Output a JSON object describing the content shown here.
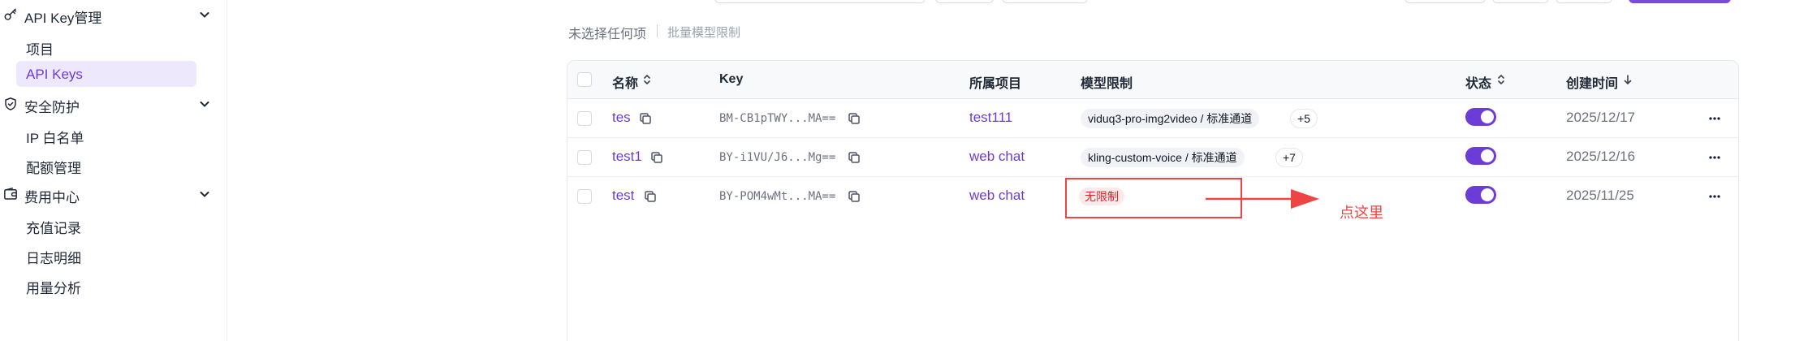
{
  "sidebar": {
    "groups": [
      {
        "label": "API Key管理",
        "icon": "key-icon",
        "items": [
          "项目",
          "API Keys"
        ]
      },
      {
        "label": "安全防护",
        "icon": "shield-icon",
        "items": [
          "IP 白名单",
          "配额管理"
        ]
      },
      {
        "label": "费用中心",
        "icon": "wallet-icon",
        "items": [
          "充值记录",
          "日志明细",
          "用量分析"
        ]
      }
    ],
    "active_item": "API Keys"
  },
  "selection": {
    "info": "未选择任何项",
    "batch_action": "批量模型限制"
  },
  "table": {
    "columns": {
      "name": "名称",
      "key": "Key",
      "project": "所属项目",
      "model_limit": "模型限制",
      "status": "状态",
      "created": "创建时间"
    },
    "rows": [
      {
        "name": "tes",
        "key": "BM-CB1pTWY...MA==",
        "project": "test111",
        "model_chip": "viduq3-pro-img2video / 标准通道",
        "extra": "+5",
        "enabled": true,
        "created": "2025/12/17"
      },
      {
        "name": "test1",
        "key": "BY-i1VU/J6...Mg==",
        "project": "web chat",
        "model_chip": "kling-custom-voice / 标准通道",
        "extra": "+7",
        "enabled": true,
        "created": "2025/12/16"
      },
      {
        "name": "test",
        "key": "BY-POM4wMt...MA==",
        "project": "web chat",
        "model_chip": "无限制",
        "extra": "",
        "enabled": true,
        "created": "2025/11/25"
      }
    ]
  },
  "annotation": {
    "text": "点这里",
    "color": "#ef4444"
  },
  "colors": {
    "accent": "#6d3bd8",
    "active_bg": "#ede8fb",
    "danger": "#dc2626"
  }
}
